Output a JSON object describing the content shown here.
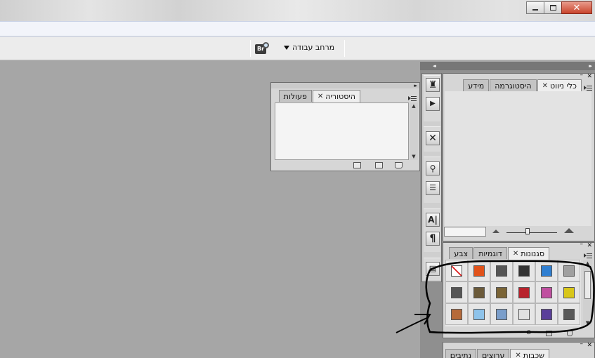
{
  "options_bar": {
    "bridge_label": "Br",
    "workspace_label": "מרחב עבודה"
  },
  "window": {
    "close_label": "✕"
  },
  "history_panel": {
    "tabs": [
      {
        "label": "היסטוריה",
        "active": true,
        "closable": true
      },
      {
        "label": "פעולות",
        "active": false,
        "closable": false
      }
    ],
    "collapse_arrows": "▸▸"
  },
  "dock": {
    "collapse_arrows_left": "◂◂",
    "collapse_arrows_right": "▸▸",
    "tool_icons": [
      "history-brush-icon",
      "play-icon",
      "tools-icon",
      "clone-source-icon",
      "layer-comps-icon",
      "character-icon",
      "paragraph-icon",
      "notes-icon"
    ],
    "char_glyph": "A|",
    "para_glyph": "¶"
  },
  "navigator_panel": {
    "tabs": [
      {
        "label": "כלי ניווט",
        "active": true,
        "closable": true
      },
      {
        "label": "היסטוגרמה",
        "active": false,
        "closable": false
      },
      {
        "label": "מידע",
        "active": false,
        "closable": false
      }
    ]
  },
  "swatches_panel": {
    "tabs": [
      {
        "label": "סגנונות",
        "active": true,
        "closable": true
      },
      {
        "label": "דוגמיות",
        "active": false,
        "closable": false
      },
      {
        "label": "צבע",
        "active": false,
        "closable": false
      }
    ],
    "styles": [
      {
        "name": "none",
        "color": "#ffffff"
      },
      {
        "name": "orange-glow",
        "color": "#e0521a"
      },
      {
        "name": "dark-gray",
        "color": "#555555"
      },
      {
        "name": "camera",
        "color": "#333333"
      },
      {
        "name": "blue",
        "color": "#2f7fd1"
      },
      {
        "name": "gray",
        "color": "#a0a0a0"
      },
      {
        "name": "dark-gradient",
        "color": "#555555"
      },
      {
        "name": "brown",
        "color": "#6b5a3a"
      },
      {
        "name": "olive-brown",
        "color": "#7a6436"
      },
      {
        "name": "red",
        "color": "#b8232d"
      },
      {
        "name": "rainbow",
        "color": "#c04fa0"
      },
      {
        "name": "yellow",
        "color": "#d8c61a"
      },
      {
        "name": "wood",
        "color": "#b56a3a"
      },
      {
        "name": "sky-blue",
        "color": "#8ec3ea"
      },
      {
        "name": "sunset",
        "color": "#7a9ecb"
      },
      {
        "name": "pattern",
        "color": "#e0e0e0"
      },
      {
        "name": "purple",
        "color": "#5a3f9a"
      },
      {
        "name": "charcoal",
        "color": "#5a5a5a"
      }
    ]
  },
  "layers_panel": {
    "tabs": [
      {
        "label": "שכבות",
        "active": true,
        "closable": true
      },
      {
        "label": "ערוצים",
        "active": false,
        "closable": false
      },
      {
        "label": "נתיבים",
        "active": false,
        "closable": false
      }
    ]
  }
}
